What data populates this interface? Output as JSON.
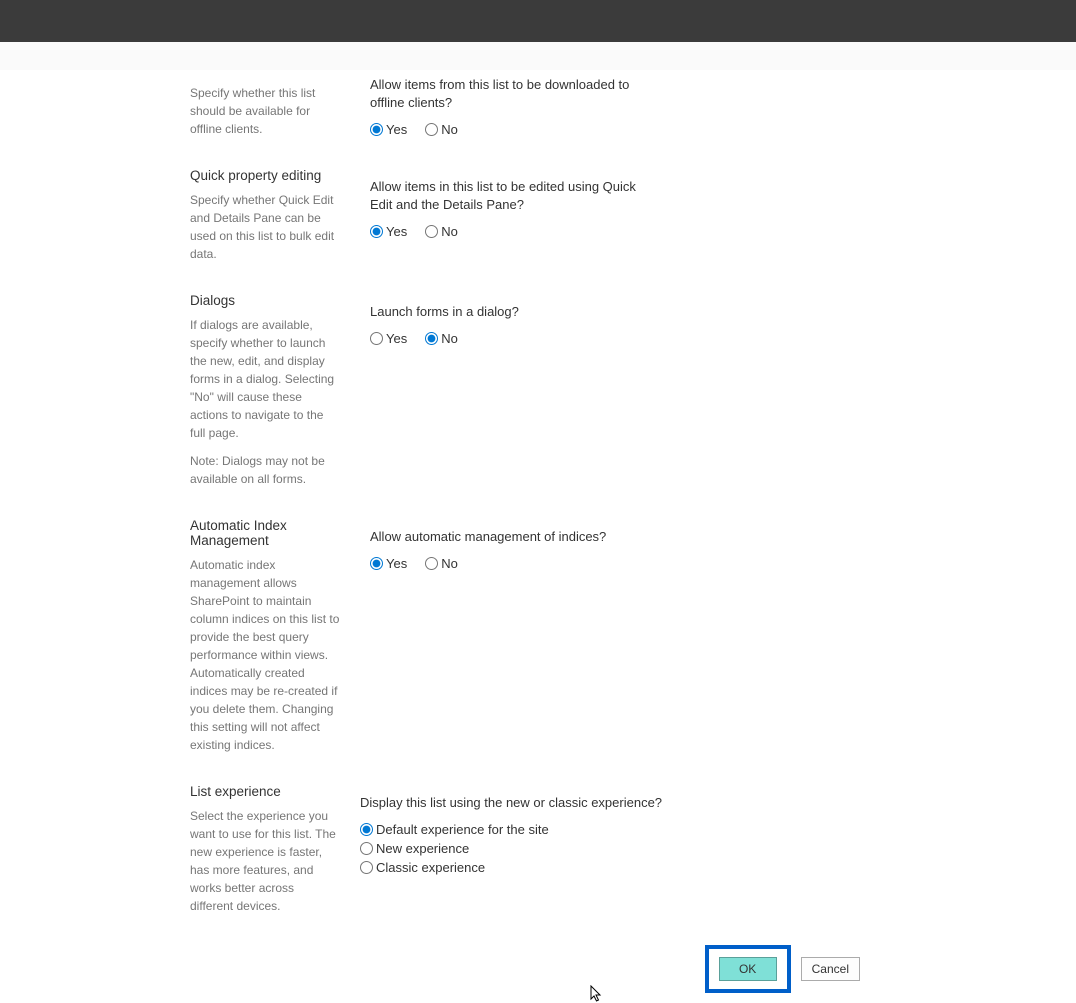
{
  "sections": {
    "offline": {
      "desc": "Specify whether this list should be available for offline clients.",
      "question": "Allow items from this list to be downloaded to offline clients?",
      "yes": "Yes",
      "no": "No"
    },
    "quick_edit": {
      "title": "Quick property editing",
      "desc": "Specify whether Quick Edit and Details Pane can be used on this list to bulk edit data.",
      "question": "Allow items in this list to be edited using Quick Edit and the Details Pane?",
      "yes": "Yes",
      "no": "No"
    },
    "dialogs": {
      "title": "Dialogs",
      "desc": "If dialogs are available, specify whether to launch the new, edit, and display forms in a dialog. Selecting \"No\" will cause these actions to navigate to the full page.",
      "note": "Note: Dialogs may not be available on all forms.",
      "question": "Launch forms in a dialog?",
      "yes": "Yes",
      "no": "No"
    },
    "index": {
      "title": "Automatic Index Management",
      "desc": "Automatic index management allows SharePoint to maintain column indices on this list to provide the best query performance within views. Automatically created indices may be re-created if you delete them. Changing this setting will not affect existing indices.",
      "question": "Allow automatic management of indices?",
      "yes": "Yes",
      "no": "No"
    },
    "experience": {
      "title": "List experience",
      "desc": "Select the experience you want to use for this list. The new experience is faster, has more features, and works better across different devices.",
      "question": "Display this list using the new or classic experience?",
      "opt1": "Default experience for the site",
      "opt2": "New experience",
      "opt3": "Classic experience"
    }
  },
  "buttons": {
    "ok": "OK",
    "cancel": "Cancel"
  }
}
